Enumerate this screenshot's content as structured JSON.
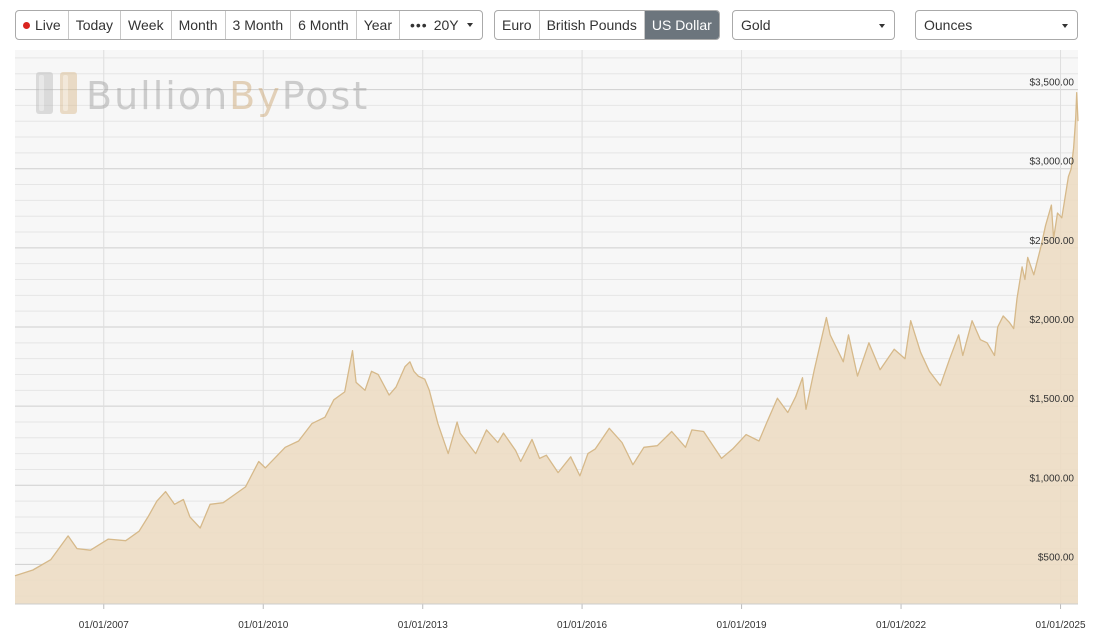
{
  "toolbar": {
    "periods": [
      {
        "key": "live",
        "label": "Live"
      },
      {
        "key": "today",
        "label": "Today"
      },
      {
        "key": "week",
        "label": "Week"
      },
      {
        "key": "month",
        "label": "Month"
      },
      {
        "key": "3month",
        "label": "3 Month"
      },
      {
        "key": "6month",
        "label": "6 Month"
      },
      {
        "key": "year",
        "label": "Year"
      }
    ],
    "more_icon": "more-dots-icon",
    "selected_range": "20Y",
    "currencies": [
      {
        "key": "eur",
        "label": "Euro",
        "active": false
      },
      {
        "key": "gbp",
        "label": "British Pounds",
        "active": false
      },
      {
        "key": "usd",
        "label": "US Dollar",
        "active": true
      }
    ],
    "metal": "Gold",
    "unit": "Ounces"
  },
  "watermark": {
    "part1": "Bullion",
    "part2": "By",
    "part3": "Post"
  },
  "colors": {
    "area_fill": "#ecdcc3",
    "area_line": "#d6b98a",
    "plot_bg": "#f7f7f7",
    "grid_minor": "#e6e6e6",
    "grid_major": "#cfcfcf",
    "live_dot": "#d9231e",
    "active_button": "#6c757d"
  },
  "chart_data": {
    "type": "area",
    "title": "",
    "xlabel": "",
    "ylabel": "",
    "y_axis_side": "right",
    "grid": true,
    "legend": "none",
    "ylim": [
      250,
      3750
    ],
    "xlim": [
      "2005-05-01",
      "2025-05-01"
    ],
    "y_ticks": [
      {
        "value": 500,
        "label": "$500.00"
      },
      {
        "value": 1000,
        "label": "$1,000.00"
      },
      {
        "value": 1500,
        "label": "$1,500.00"
      },
      {
        "value": 2000,
        "label": "$2,000.00"
      },
      {
        "value": 2500,
        "label": "$2,500.00"
      },
      {
        "value": 3000,
        "label": "$3,000.00"
      },
      {
        "value": 3500,
        "label": "$3,500.00"
      }
    ],
    "x_ticks": [
      {
        "value": "2007-01-01",
        "label": "01/01/2007"
      },
      {
        "value": "2010-01-01",
        "label": "01/01/2010"
      },
      {
        "value": "2013-01-01",
        "label": "01/01/2013"
      },
      {
        "value": "2016-01-01",
        "label": "01/01/2016"
      },
      {
        "value": "2019-01-01",
        "label": "01/01/2019"
      },
      {
        "value": "2022-01-01",
        "label": "01/01/2022"
      },
      {
        "value": "2025-01-01",
        "label": "01/01/2025"
      }
    ],
    "series": [
      {
        "x": [
          "2005-05-01",
          "2005-09-01",
          "2006-01-01",
          "2006-05-01",
          "2006-07-01",
          "2006-10-01",
          "2007-02-01",
          "2007-06-01",
          "2007-09-01",
          "2007-11-01",
          "2008-01-01",
          "2008-03-01",
          "2008-05-01",
          "2008-07-01",
          "2008-08-15",
          "2008-10-25",
          "2009-01-01",
          "2009-04-01",
          "2009-06-01",
          "2009-09-01",
          "2009-12-01",
          "2010-01-15",
          "2010-06-01",
          "2010-09-01",
          "2010-12-01",
          "2011-03-01",
          "2011-05-01",
          "2011-07-15",
          "2011-09-06",
          "2011-10-01",
          "2011-12-01",
          "2012-01-15",
          "2012-03-01",
          "2012-05-15",
          "2012-07-01",
          "2012-09-01",
          "2012-10-05",
          "2012-11-01",
          "2012-12-01",
          "2013-01-15",
          "2013-02-15",
          "2013-04-15",
          "2013-06-25",
          "2013-08-25",
          "2013-09-15",
          "2013-12-31",
          "2014-03-15",
          "2014-06-01",
          "2014-07-10",
          "2014-10-01",
          "2014-11-05",
          "2015-01-22",
          "2015-03-15",
          "2015-05-01",
          "2015-07-20",
          "2015-10-15",
          "2015-12-17",
          "2016-02-10",
          "2016-04-01",
          "2016-07-06",
          "2016-10-01",
          "2016-12-15",
          "2017-03-01",
          "2017-06-01",
          "2017-09-08",
          "2017-12-12",
          "2018-01-25",
          "2018-04-15",
          "2018-08-16",
          "2018-11-01",
          "2019-02-01",
          "2019-05-01",
          "2019-06-25",
          "2019-09-04",
          "2019-11-15",
          "2020-01-08",
          "2020-02-24",
          "2020-03-19",
          "2020-05-15",
          "2020-08-06",
          "2020-09-01",
          "2020-11-30",
          "2021-01-05",
          "2021-03-08",
          "2021-05-25",
          "2021-08-10",
          "2021-11-15",
          "2022-01-28",
          "2022-03-08",
          "2022-05-15",
          "2022-07-15",
          "2022-09-28",
          "2022-12-01",
          "2023-02-01",
          "2023-03-01",
          "2023-05-04",
          "2023-06-30",
          "2023-08-15",
          "2023-10-05",
          "2023-10-27",
          "2023-12-04",
          "2024-01-15",
          "2024-02-14",
          "2024-03-08",
          "2024-04-12",
          "2024-05-01",
          "2024-05-20",
          "2024-07-01",
          "2024-08-20",
          "2024-09-20",
          "2024-10-30",
          "2024-11-14",
          "2024-12-11",
          "2025-01-10",
          "2025-02-24",
          "2025-03-15",
          "2025-04-01",
          "2025-04-15",
          "2025-04-22",
          "2025-05-01"
        ],
        "y": [
          428,
          465,
          530,
          680,
          600,
          590,
          660,
          650,
          710,
          800,
          900,
          960,
          880,
          910,
          800,
          730,
          880,
          890,
          930,
          990,
          1150,
          1110,
          1240,
          1280,
          1390,
          1430,
          1540,
          1590,
          1850,
          1650,
          1600,
          1720,
          1700,
          1570,
          1620,
          1750,
          1780,
          1720,
          1690,
          1670,
          1600,
          1390,
          1200,
          1400,
          1330,
          1200,
          1350,
          1270,
          1330,
          1220,
          1150,
          1290,
          1170,
          1190,
          1080,
          1180,
          1060,
          1200,
          1230,
          1360,
          1270,
          1130,
          1240,
          1250,
          1340,
          1240,
          1350,
          1340,
          1170,
          1230,
          1320,
          1280,
          1400,
          1550,
          1460,
          1560,
          1680,
          1480,
          1730,
          2060,
          1950,
          1780,
          1950,
          1690,
          1900,
          1730,
          1860,
          1800,
          2040,
          1840,
          1720,
          1630,
          1800,
          1950,
          1820,
          2040,
          1920,
          1900,
          1820,
          2000,
          2070,
          2030,
          1990,
          2180,
          2380,
          2300,
          2440,
          2330,
          2510,
          2640,
          2770,
          2560,
          2720,
          2690,
          2950,
          3000,
          3130,
          3320,
          3480,
          3300
        ]
      }
    ]
  }
}
